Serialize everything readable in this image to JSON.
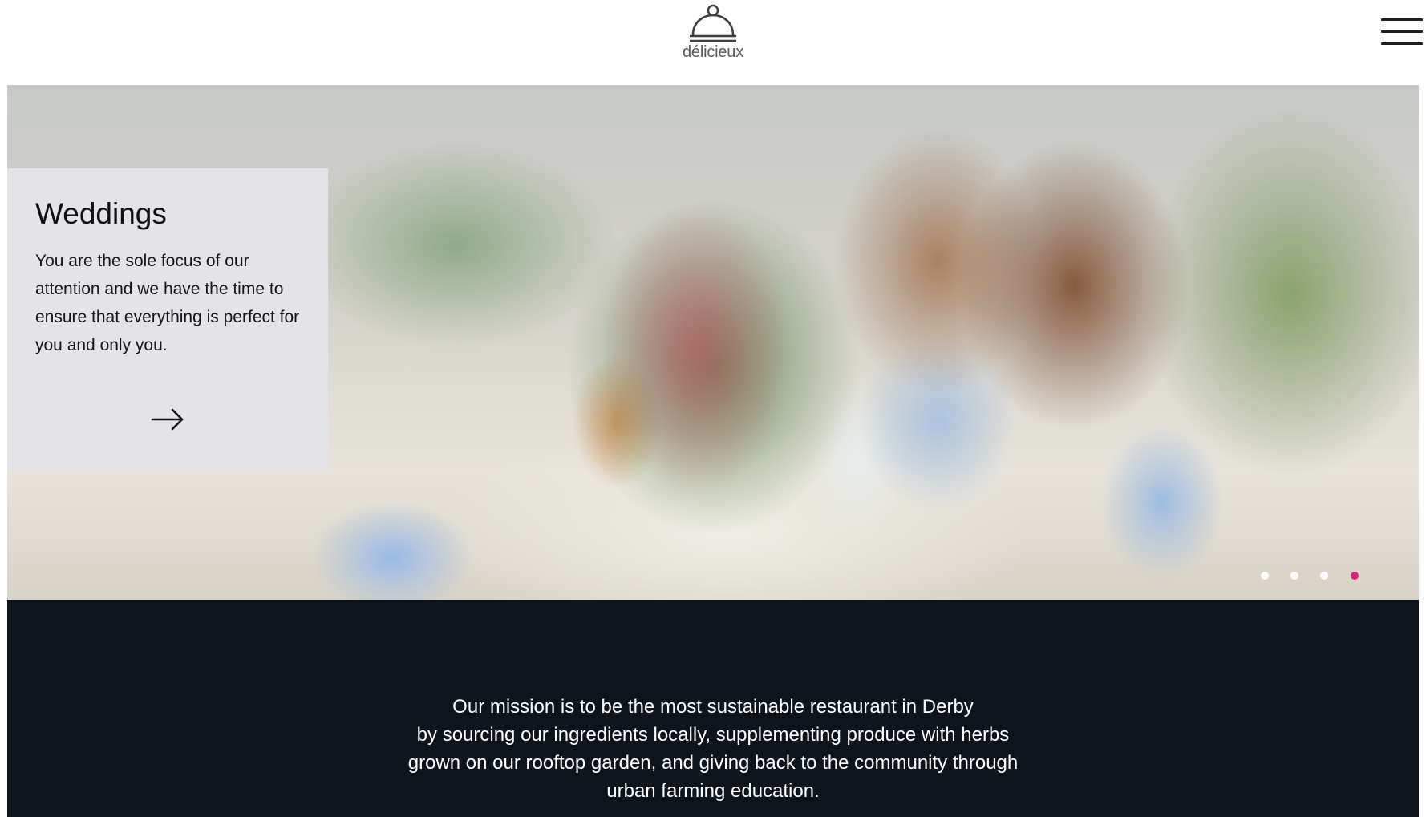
{
  "brand": {
    "name": "délicieux",
    "logo_icon": "cloche-icon"
  },
  "header": {
    "menu_icon": "hamburger-menu-icon"
  },
  "hero": {
    "image_subject": "",
    "card": {
      "title": "Weddings",
      "body": "You are the sole focus of our attention and we have the time to ensure that everything is perfect for you and only you.",
      "arrow_icon": "arrow-right-icon"
    },
    "carousel": {
      "slide_count": 4,
      "active_index": 3,
      "active_color": "#e0207a",
      "inactive_color": "#ffffff"
    }
  },
  "mission": {
    "lines": [
      "Our mission is to be the most sustainable restaurant in Derby",
      "by sourcing our ingredients locally, supplementing produce with herbs",
      "grown on our rooftop garden, and giving back to the community through",
      "urban farming education."
    ],
    "background": "#0d141c"
  }
}
